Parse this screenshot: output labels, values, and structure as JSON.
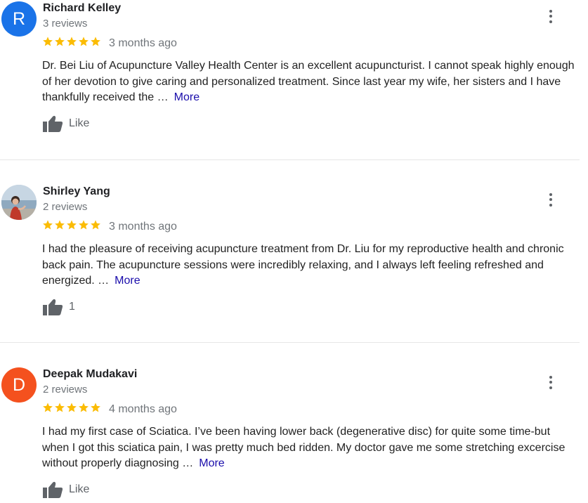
{
  "reviews": [
    {
      "avatar_letter": "R",
      "avatar_color": "#1a73e8",
      "name": "Richard Kelley",
      "review_count": "3 reviews",
      "rating": 5,
      "date": "3 months ago",
      "text": "Dr. Bei Liu of Acupuncture Valley Health Center is an excellent acupuncturist. I cannot speak highly enough of her devotion to give caring and personalized treatment. Since last year my wife, her sisters and I have thankfully received the …",
      "more": "More",
      "like": "Like"
    },
    {
      "avatar_letter": "",
      "avatar_color": "#b9c9d8",
      "name": "Shirley Yang",
      "review_count": "2 reviews",
      "rating": 5,
      "date": "3 months ago",
      "text": "I had the pleasure of receiving acupuncture treatment from Dr. Liu for my reproductive health and chronic back pain. The acupuncture sessions were incredibly relaxing, and I always left feeling refreshed and energized. …",
      "more": "More",
      "like": "1"
    },
    {
      "avatar_letter": "D",
      "avatar_color": "#f4511e",
      "name": "Deepak Mudakavi",
      "review_count": "2 reviews",
      "rating": 5,
      "date": "4 months ago",
      "text": "I had my first case of Sciatica.  I’ve been having lower back (degenerative disc) for quite some time-but when I got this sciatica pain, I was pretty much bed ridden.  My doctor gave me some stretching excercise without properly diagnosing …",
      "more": "More",
      "like": "Like"
    }
  ],
  "icons": {
    "star": "star-icon",
    "like": "thumbs-up-icon",
    "menu": "more-vert-icon"
  },
  "colors": {
    "star": "#fbbc04",
    "link": "#1a0dab",
    "secondary_text": "#70757a"
  }
}
